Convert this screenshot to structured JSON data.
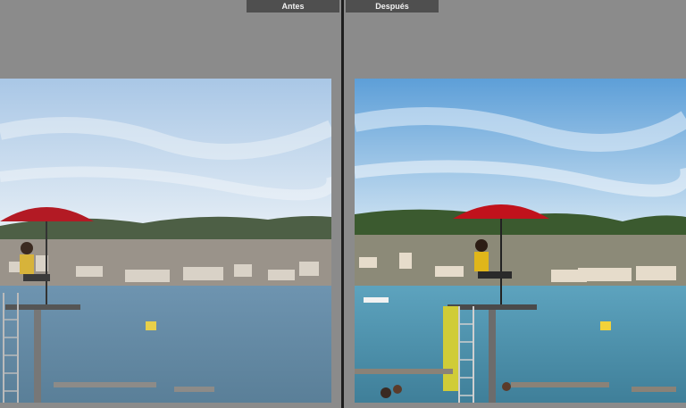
{
  "compare": {
    "before_label": "Antes",
    "after_label": "Después"
  },
  "colors": {
    "background": "#8b8b8b",
    "divider": "#1e1e1e",
    "tab": "#4f4f4f",
    "before_sky": "#cfe0f0",
    "after_sky": "#7fb7e8",
    "before_water": "#5f8aa8",
    "after_water": "#4f93b0",
    "umbrella": "#b31a24"
  },
  "images": {
    "before": "lake-scene-before",
    "after": "lake-scene-after"
  }
}
